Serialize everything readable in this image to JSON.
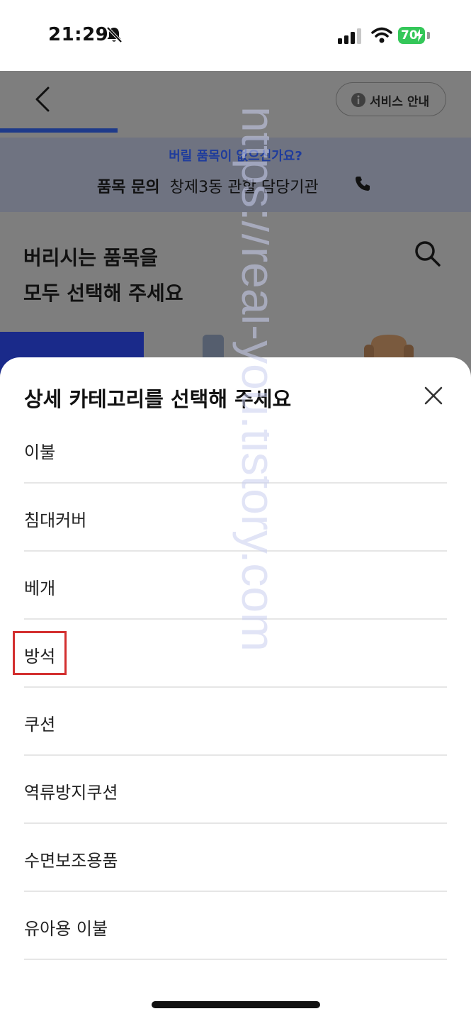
{
  "status_bar": {
    "time": "21:29",
    "battery": "70"
  },
  "header": {
    "service_label": "서비스 안내",
    "progress_fraction": 0.25
  },
  "inquiry": {
    "question": "버릴 품목이 없으신가요?",
    "label": "품목 문의",
    "agency": "창제3동 관할 담당기관"
  },
  "prompt": {
    "line1": "버리시는 품목을",
    "line2": "모두 선택해 주세요"
  },
  "sheet": {
    "title": "상세 카테고리를 선택해 주세요",
    "options": [
      "이불",
      "침대커버",
      "베개",
      "방석",
      "쿠션",
      "역류방지쿠션",
      "수면보조용품",
      "유아용 이불"
    ]
  },
  "watermark": "https://real-you.tistory.com",
  "colors": {
    "accent": "#1e3a8a",
    "highlight": "#d32f2f",
    "battery": "#34c759"
  }
}
